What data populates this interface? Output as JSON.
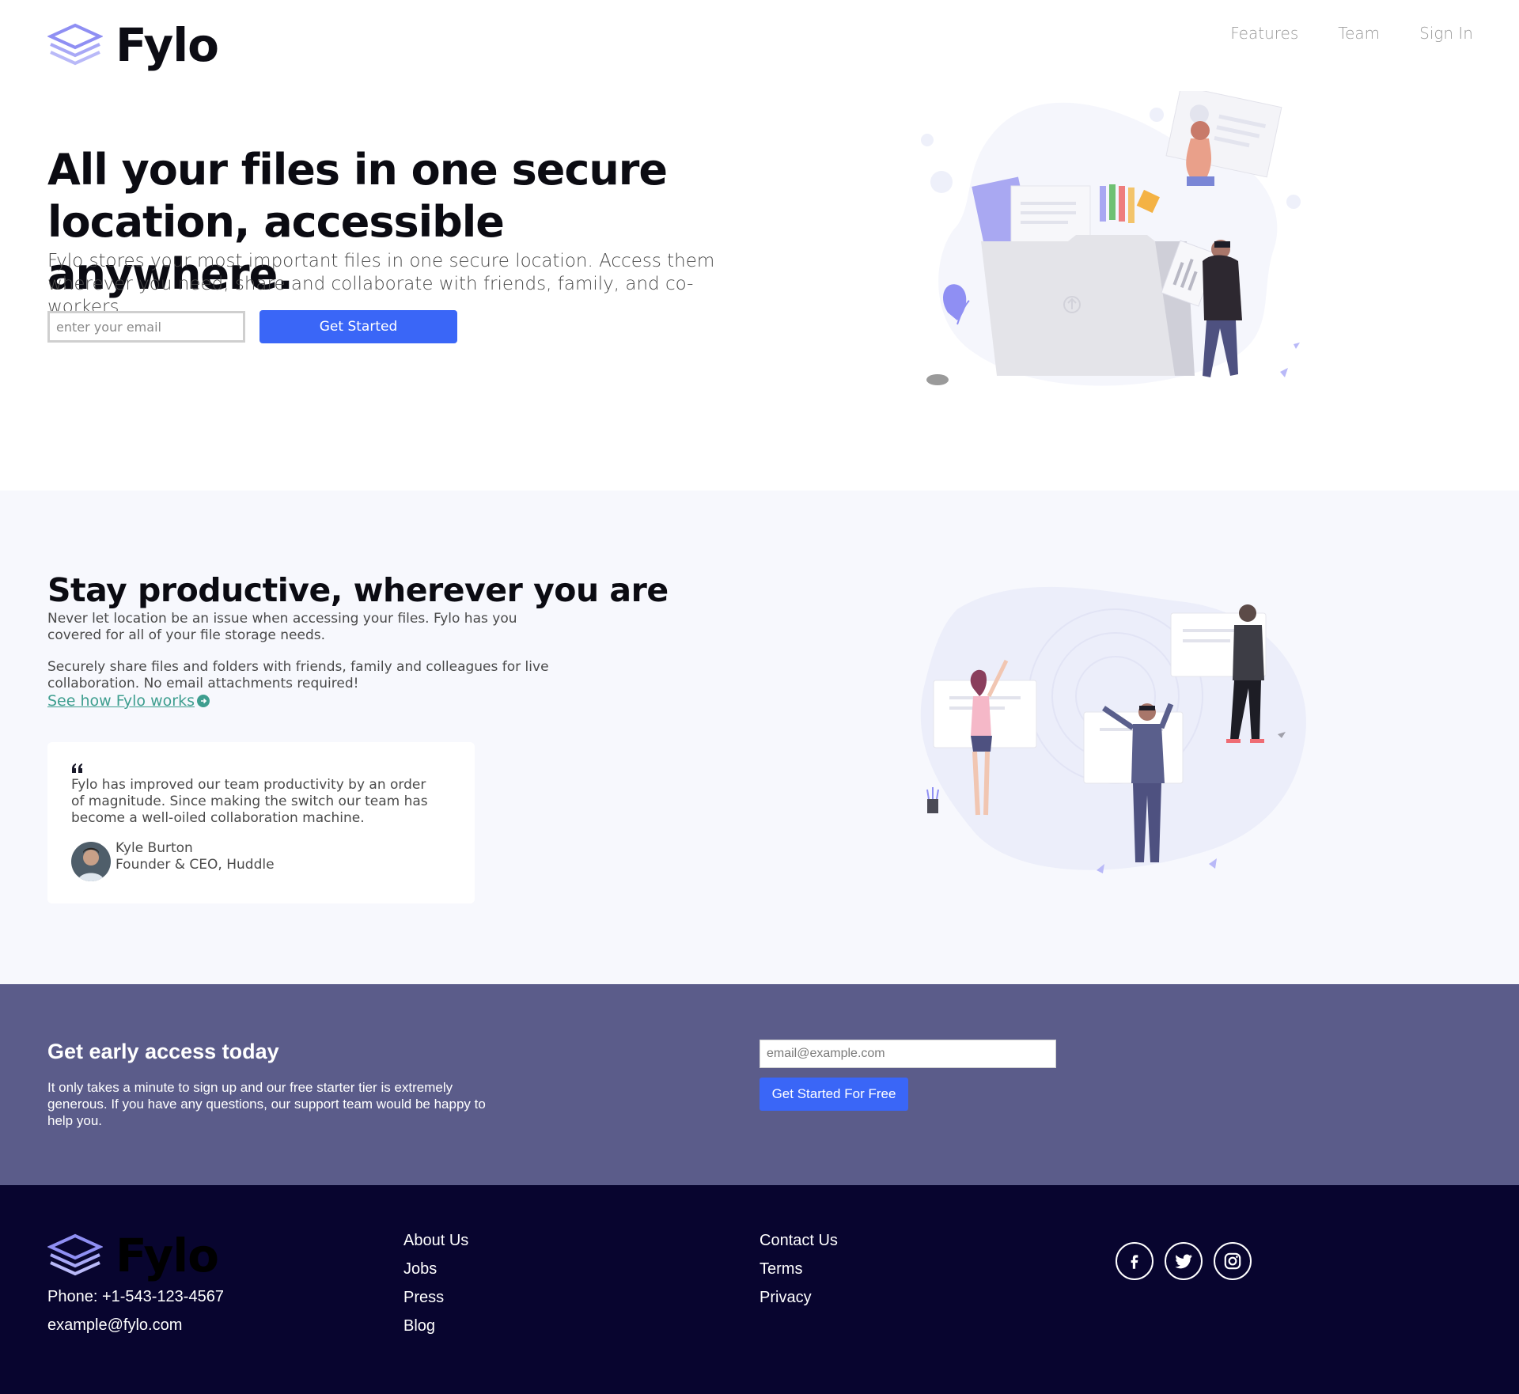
{
  "header": {
    "brand": "Fylo",
    "nav": [
      {
        "label": "Features"
      },
      {
        "label": "Team"
      },
      {
        "label": "Sign In"
      }
    ]
  },
  "hero": {
    "title": "All your files in one secure location, accessible anywhere.",
    "subtitle": "Fylo stores your most important files in one secure location. Access them wherever you need, share and collaborate with friends, family, and co-workers.",
    "email_placeholder": "enter your email",
    "cta_label": "Get Started"
  },
  "productive": {
    "title": "Stay productive, wherever you are",
    "paragraph1": "Never let location be an issue when accessing your files. Fylo has you covered for all of your file storage needs.",
    "paragraph2": "Securely share files and folders with friends, family and colleagues for live collaboration. No email attachments required!",
    "link_label": "See how Fylo works",
    "testimonial": {
      "quote": "Fylo has improved our team productivity by an order of magnitude. Since making the switch our team has become a well-oiled collaboration machine.",
      "name": "Kyle Burton",
      "role": "Founder & CEO, Huddle"
    }
  },
  "early_access": {
    "title": "Get early access today",
    "text": "It only takes a minute to sign up and our free starter tier is extremely generous. If you have any questions, our support team would be happy to help you.",
    "email_placeholder": "email@example.com",
    "cta_label": "Get Started For Free"
  },
  "footer": {
    "brand": "Fylo",
    "phone": "Phone: +1-543-123-4567",
    "email": "example@fylo.com",
    "col1": [
      {
        "label": "About Us"
      },
      {
        "label": "Jobs"
      },
      {
        "label": "Press"
      },
      {
        "label": "Blog"
      }
    ],
    "col2": [
      {
        "label": "Contact Us"
      },
      {
        "label": "Terms"
      },
      {
        "label": "Privacy"
      }
    ],
    "socials": [
      "facebook-icon",
      "twitter-icon",
      "instagram-icon"
    ]
  },
  "colors": {
    "accent": "#3a66f7",
    "early_bg": "#5b5c8a",
    "footer_bg": "#08052f",
    "link": "#3e9e8f"
  }
}
